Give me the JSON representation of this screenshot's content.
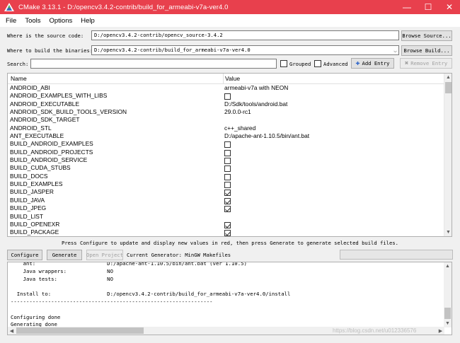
{
  "window": {
    "title": "CMake 3.13.1 - D:/opencv3.4.2-contrib/build_for_armeabi-v7a-ver4.0",
    "accent": "#e8404d",
    "minimize": "—",
    "maximize": "☐",
    "close": "✕"
  },
  "menu": [
    {
      "label": "File"
    },
    {
      "label": "Tools"
    },
    {
      "label": "Options"
    },
    {
      "label": "Help"
    }
  ],
  "source": {
    "label": "Where is the source code:",
    "value": "D:/opencv3.4.2-contrib/opencv_source-3.4.2",
    "browse": "Browse Source..."
  },
  "binaries": {
    "label": "Where to build the binaries:",
    "value": "D:/opencv3.4.2-contrib/build_for_armeabi-v7a-ver4.0",
    "browse": "Browse Build..."
  },
  "search": {
    "label": "Search:",
    "value": "",
    "grouped": "Grouped",
    "advanced": "Advanced",
    "add_entry": "Add Entry",
    "remove_entry": "Remove Entry"
  },
  "table": {
    "headers": {
      "name": "Name",
      "value": "Value"
    },
    "rows": [
      {
        "name": "ANDROID_ABI",
        "type": "text",
        "value": "armeabi-v7a with NEON"
      },
      {
        "name": "ANDROID_EXAMPLES_WITH_LIBS",
        "type": "check",
        "checked": false
      },
      {
        "name": "ANDROID_EXECUTABLE",
        "type": "text",
        "value": "D:/Sdk/tools/android.bat"
      },
      {
        "name": "ANDROID_SDK_BUILD_TOOLS_VERSION",
        "type": "text",
        "value": "29.0.0-rc1"
      },
      {
        "name": "ANDROID_SDK_TARGET",
        "type": "text",
        "value": ""
      },
      {
        "name": "ANDROID_STL",
        "type": "text",
        "value": "c++_shared"
      },
      {
        "name": "ANT_EXECUTABLE",
        "type": "text",
        "value": "D:/apache-ant-1.10.5/bin/ant.bat"
      },
      {
        "name": "BUILD_ANDROID_EXAMPLES",
        "type": "check",
        "checked": false
      },
      {
        "name": "BUILD_ANDROID_PROJECTS",
        "type": "check",
        "checked": false
      },
      {
        "name": "BUILD_ANDROID_SERVICE",
        "type": "check",
        "checked": false
      },
      {
        "name": "BUILD_CUDA_STUBS",
        "type": "check",
        "checked": false
      },
      {
        "name": "BUILD_DOCS",
        "type": "check",
        "checked": false
      },
      {
        "name": "BUILD_EXAMPLES",
        "type": "check",
        "checked": false
      },
      {
        "name": "BUILD_JASPER",
        "type": "check",
        "checked": true
      },
      {
        "name": "BUILD_JAVA",
        "type": "check",
        "checked": true
      },
      {
        "name": "BUILD_JPEG",
        "type": "check",
        "checked": true
      },
      {
        "name": "BUILD_LIST",
        "type": "text",
        "value": ""
      },
      {
        "name": "BUILD_OPENEXR",
        "type": "check",
        "checked": true
      },
      {
        "name": "BUILD_PACKAGE",
        "type": "check",
        "checked": true
      }
    ]
  },
  "status": "Press Configure to update and display new values in red, then press Generate to generate selected build files.",
  "actions": {
    "configure": "Configure",
    "generate": "Generate",
    "open_project": "Open Project",
    "generator": "Current Generator: MinGW Makefiles"
  },
  "output": {
    "lines": [
      "    ant:                       D:/apache-ant-1.10.5/bin/ant.bat (ver 1.10.5)",
      "    Java wrappers:             NO",
      "    Java tests:                NO",
      "",
      "  Install to:                  D:/opencv3.4.2-contrib/build_for_armeabi-v7a-ver4.0/install",
      "-----------------------------------------------------------------",
      "",
      "Configuring done",
      "Generating done"
    ]
  },
  "watermark": "https://blog.csdn.net/u012336576"
}
